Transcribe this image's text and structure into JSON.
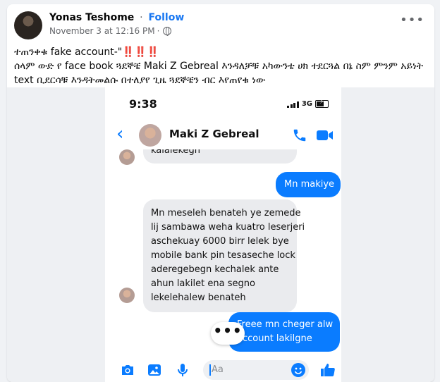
{
  "post": {
    "author": "Yonas Teshome",
    "follow_label": "Follow",
    "separator": "·",
    "timestamp": "November 3 at 12:16 PM",
    "privacy_icon": "globe-icon",
    "more_icon": "more-icon",
    "caption_line1": "ተጠንቀቁ fake account-\"",
    "caption_alert": "‼️‼️‼️",
    "caption_line2": "ሰላም ውድ የ face book ጓደኞቼ Maki Z Gebreal እንዳለቻቹ አካውንቴ ሀክ ተደርጓል በኔ ስም ምንም አይነት text ቢደርሳቹ እንዳትመልሱ በተለያየ ጊዜ ጓደኞቼን ብር እየጠየቁ ነው"
  },
  "phone": {
    "status_time": "9:38",
    "network": "3G",
    "contact_name": "Maki Z Gebreal",
    "back_icon": "chevron-left-icon",
    "call_icon": "phone-icon",
    "video_icon": "video-icon"
  },
  "messages": {
    "m1": [
      "kalalekegh"
    ],
    "m2": [
      "Mn makiye"
    ],
    "m3": [
      "Mn meseleh benateh ye zemede",
      "lij sambawa weha kuatro leserjeri",
      "aschekuay 6000 birr lelek bye",
      "mobile bank pin tesaseche lock",
      "aderegebegn kechalek ante",
      "ahun lakilet ena segno",
      "lekelehalew benateh"
    ],
    "m4": [
      "Freee mn cheger alw",
      "account lakilgne"
    ]
  },
  "composer": {
    "placeholder": "Aa",
    "icons": [
      "camera-icon",
      "image-icon",
      "microphone-icon",
      "emoji-icon",
      "like-icon"
    ]
  },
  "colors": {
    "messenger_blue": "#0a7cff",
    "facebook_blue": "#1877f2"
  }
}
